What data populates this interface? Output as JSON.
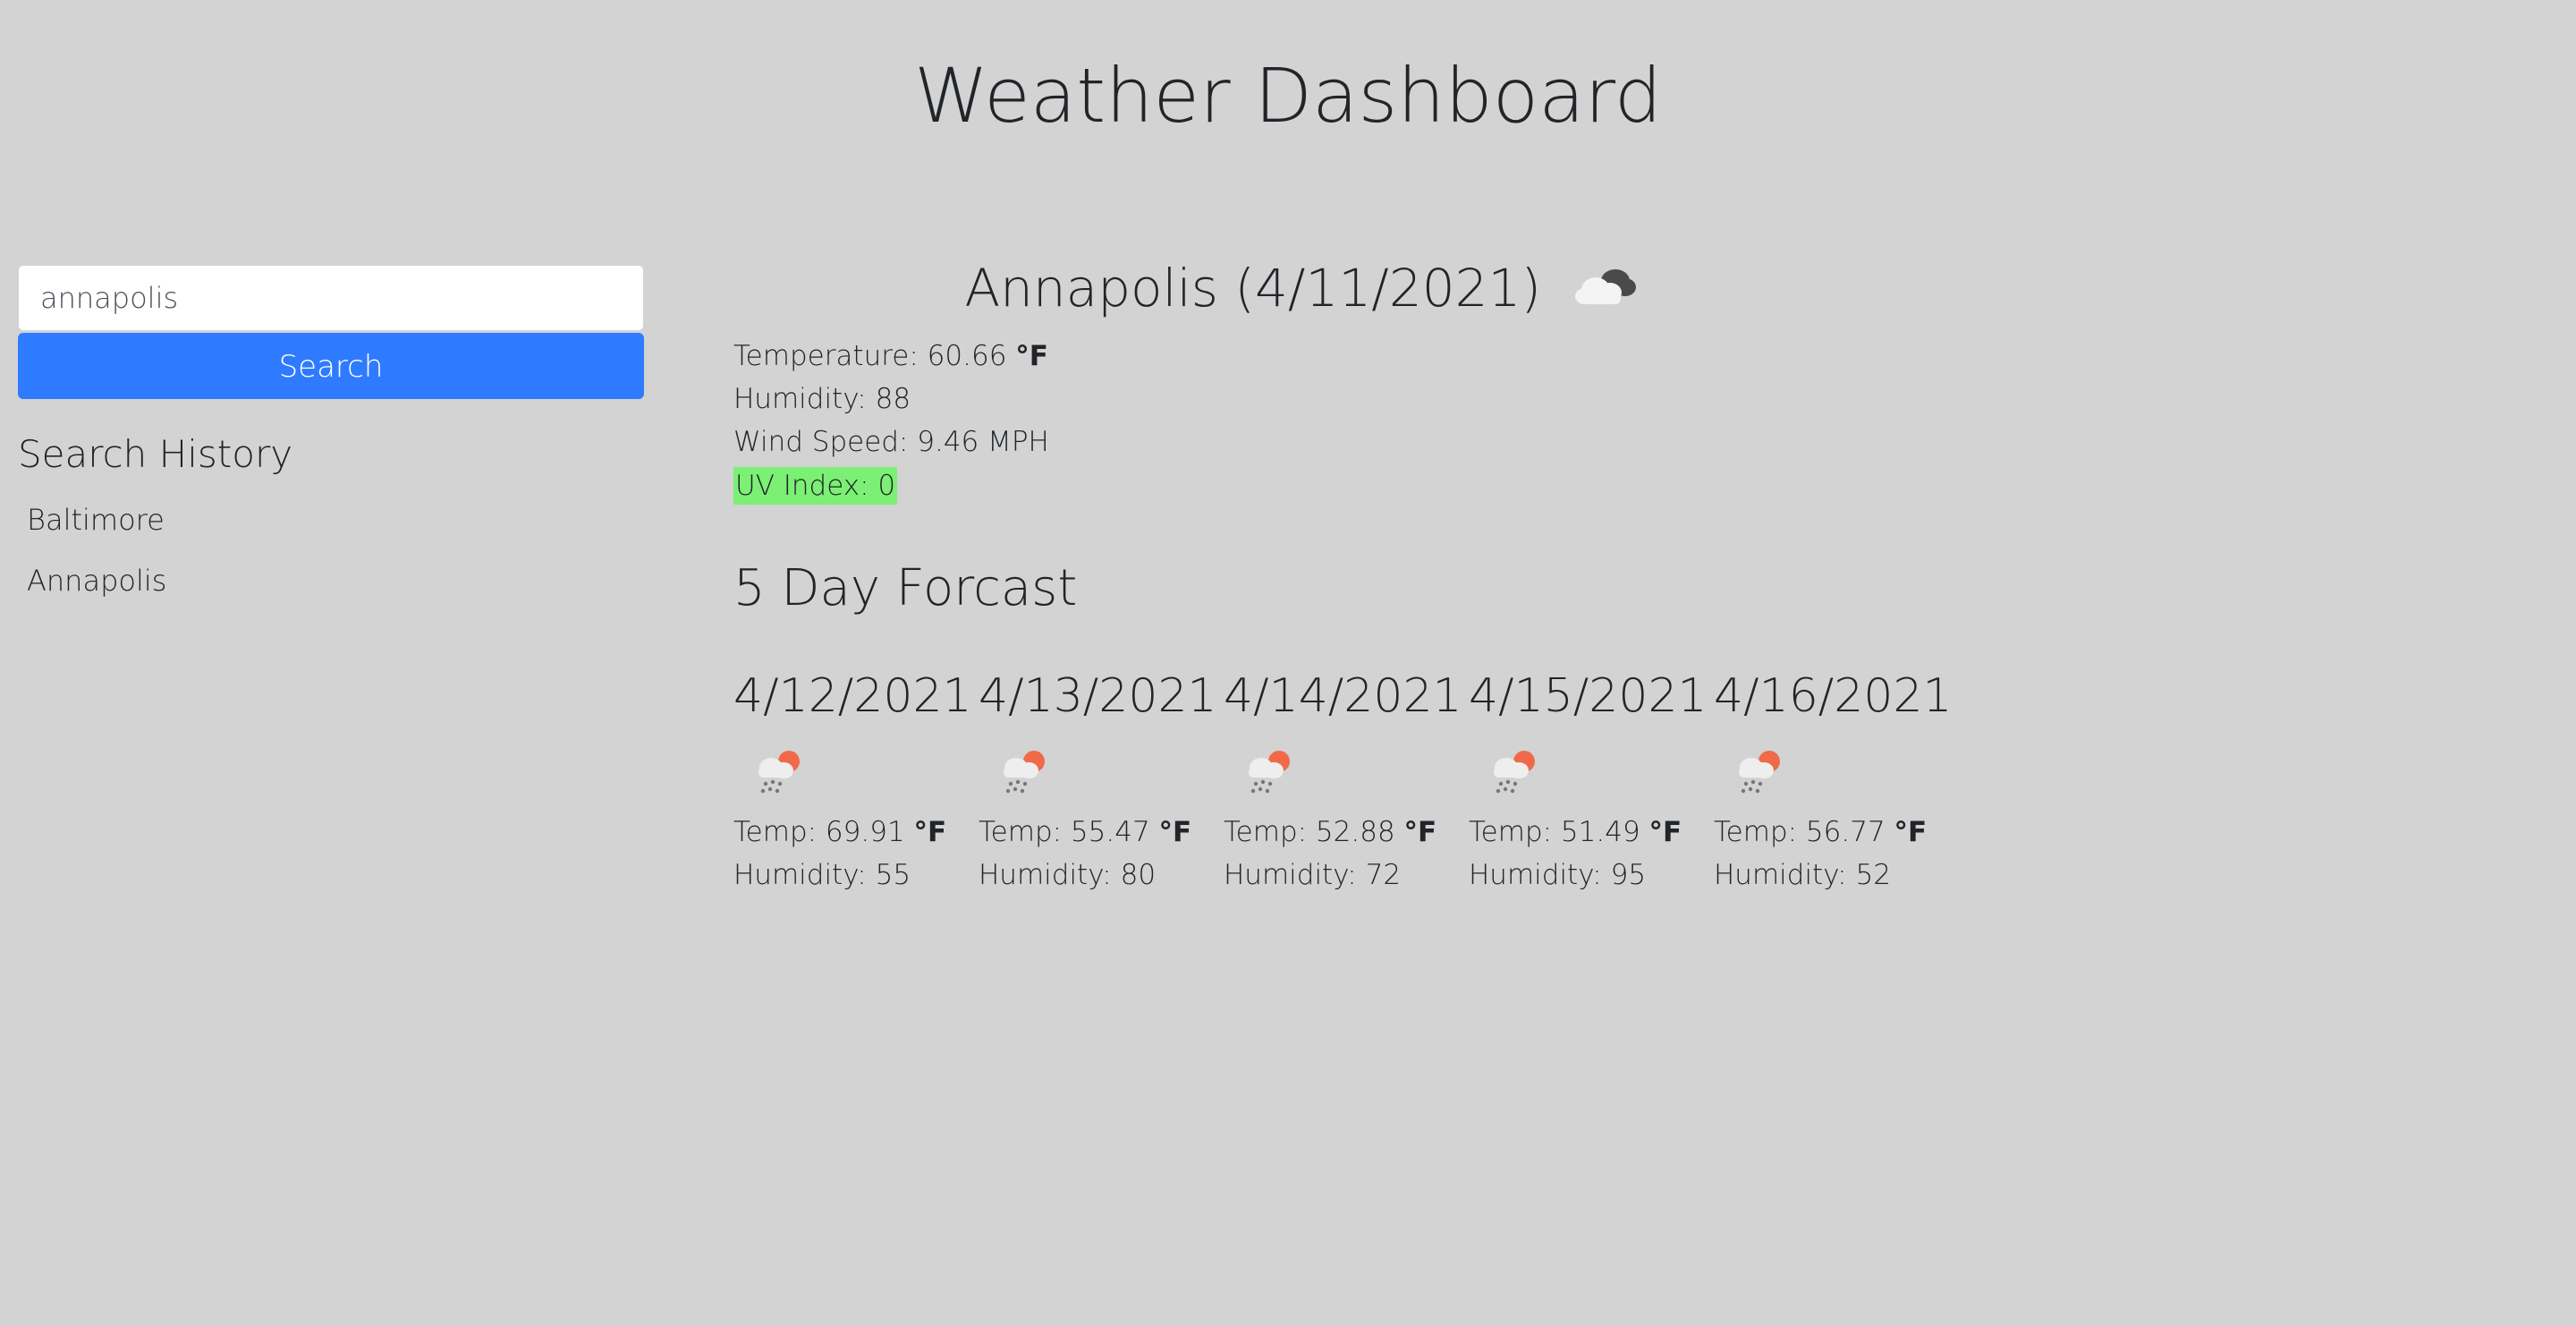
{
  "header": {
    "title": "Weather Dashboard"
  },
  "sidebar": {
    "search_value": "annapolis",
    "search_button_label": "Search",
    "history_title": "Search History",
    "history": [
      {
        "label": "Baltimore"
      },
      {
        "label": "Annapolis"
      }
    ]
  },
  "current": {
    "heading": "Annapolis (4/11/2021)",
    "icon": "cloudy-icon",
    "temperature_label": "Temperature: 60.66",
    "temperature_unit": "°F",
    "humidity_label": "Humidity: 88",
    "wind_label": "Wind Speed: 9.46 MPH",
    "uv_label": "UV Index: 0",
    "uv_color": "#7cf074"
  },
  "forecast": {
    "title": "5 Day Forcast",
    "days": [
      {
        "date": "4/12/2021",
        "icon": "rain-sun-icon",
        "temp_label": "Temp: 69.91",
        "temp_unit": "°F",
        "humidity_label": "Humidity: 55"
      },
      {
        "date": "4/13/2021",
        "icon": "rain-sun-icon",
        "temp_label": "Temp: 55.47",
        "temp_unit": "°F",
        "humidity_label": "Humidity: 80"
      },
      {
        "date": "4/14/2021",
        "icon": "rain-sun-icon",
        "temp_label": "Temp: 52.88",
        "temp_unit": "°F",
        "humidity_label": "Humidity: 72"
      },
      {
        "date": "4/15/2021",
        "icon": "rain-sun-icon",
        "temp_label": "Temp: 51.49",
        "temp_unit": "°F",
        "humidity_label": "Humidity: 95"
      },
      {
        "date": "4/16/2021",
        "icon": "rain-sun-icon",
        "temp_label": "Temp: 56.77",
        "temp_unit": "°F",
        "humidity_label": "Humidity: 52"
      }
    ]
  },
  "colors": {
    "background": "#d3d3d3",
    "button": "#2f7bff",
    "text": "#212529"
  }
}
